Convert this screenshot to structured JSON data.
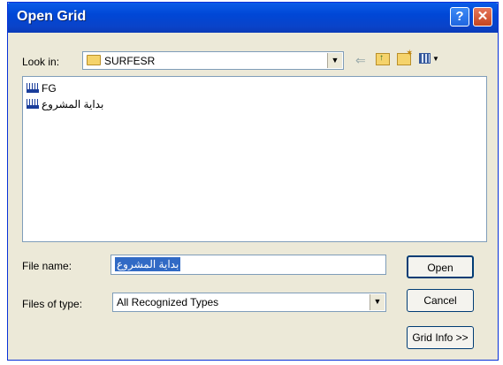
{
  "window": {
    "title": "Open Grid",
    "help_glyph": "?",
    "close_glyph": "✕"
  },
  "look_in": {
    "label": "Look in:",
    "value": "SURFESR"
  },
  "toolbar": {
    "icons": [
      "back-icon",
      "up-folder-icon",
      "new-folder-icon",
      "view-menu-icon"
    ]
  },
  "files": [
    {
      "name": "FG",
      "icon": "grid-file-icon"
    },
    {
      "name": "بداية المشروع",
      "icon": "grid-file-icon"
    }
  ],
  "file_name": {
    "label": "File name:",
    "value": "بداية المشروع"
  },
  "file_type": {
    "label": "Files of type:",
    "value": "All Recognized Types"
  },
  "buttons": {
    "open": "Open",
    "cancel": "Cancel",
    "grid_info": "Grid Info >>"
  }
}
